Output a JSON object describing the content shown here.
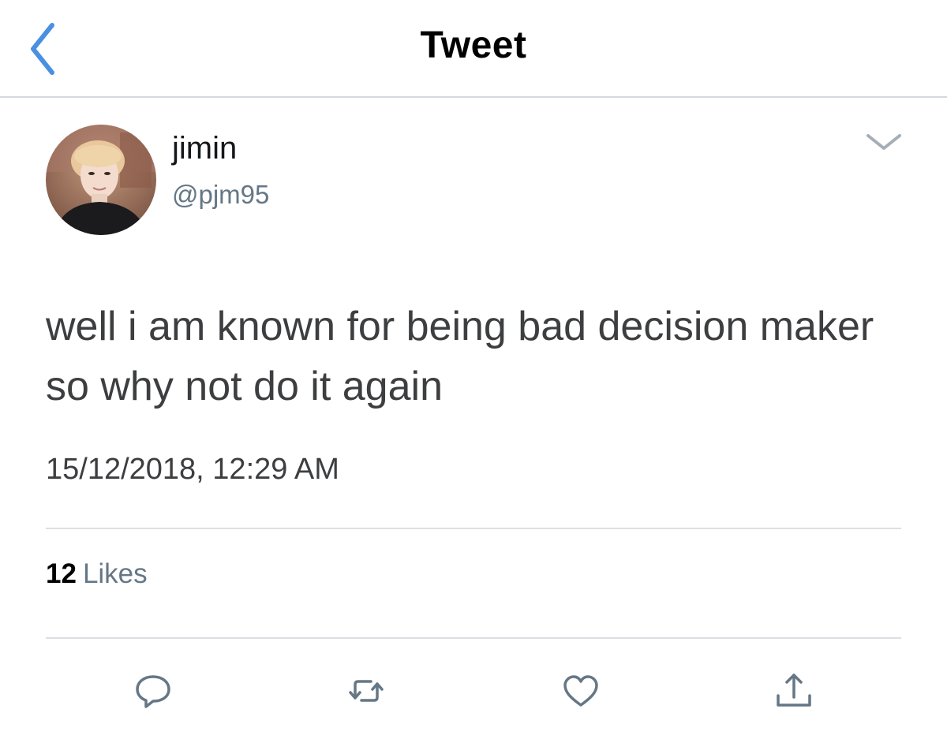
{
  "nav": {
    "title": "Tweet",
    "back_icon": "chevron-left-icon",
    "accent_color": "#4a90e2"
  },
  "author": {
    "display_name": "jimin",
    "handle": "@pjm95"
  },
  "tweet": {
    "text": "well i am known for being bad decision maker so why not do it again",
    "timestamp": "15/12/2018, 12:29 AM"
  },
  "stats": {
    "likes_count": "12",
    "likes_label": "Likes"
  },
  "actions": [
    {
      "icon": "reply-icon"
    },
    {
      "icon": "retweet-icon"
    },
    {
      "icon": "like-icon"
    },
    {
      "icon": "share-icon"
    }
  ],
  "colors": {
    "secondary_text": "#657786",
    "body_text": "#3d3e40",
    "divider": "#dcdfe3"
  }
}
